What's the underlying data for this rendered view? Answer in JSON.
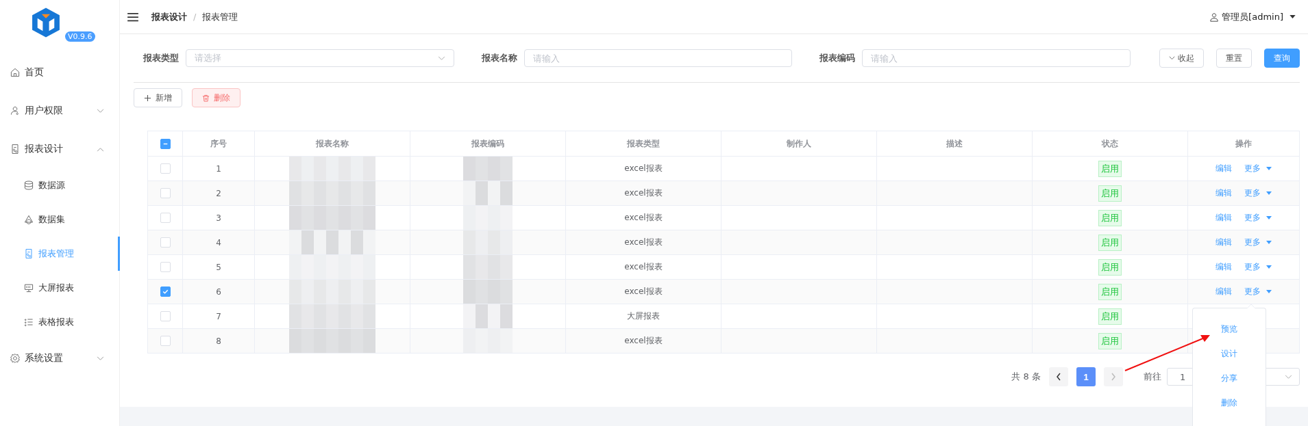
{
  "logo": {
    "version": "V0.9.6"
  },
  "sidebar": {
    "items": [
      {
        "label": "首页",
        "selected": false
      },
      {
        "label": "用户权限",
        "selected": false,
        "expanded": false
      },
      {
        "label": "报表设计",
        "selected": false,
        "expanded": true,
        "children": [
          {
            "label": "数据源",
            "selected": false
          },
          {
            "label": "数据集",
            "selected": false
          },
          {
            "label": "报表管理",
            "selected": true
          },
          {
            "label": "大屏报表",
            "selected": false
          },
          {
            "label": "表格报表",
            "selected": false
          }
        ]
      },
      {
        "label": "系统设置",
        "selected": false,
        "expanded": false
      }
    ]
  },
  "breadcrumb": [
    "报表设计",
    "报表管理"
  ],
  "breadcrumb_separator": "/",
  "user": {
    "name": "管理员[admin]"
  },
  "filters": [
    {
      "label": "报表类型",
      "kind": "select",
      "placeholder": "请选择"
    },
    {
      "label": "报表名称",
      "kind": "input",
      "placeholder": "请输入"
    },
    {
      "label": "报表编码",
      "kind": "input",
      "placeholder": "请输入"
    }
  ],
  "filter_buttons": [
    {
      "label": "收起",
      "kind": "collapse"
    },
    {
      "label": "重置",
      "kind": "plain"
    },
    {
      "label": "查询",
      "kind": "primary"
    }
  ],
  "actions": [
    {
      "label": "新增",
      "kind": "add"
    },
    {
      "label": "删除",
      "kind": "delete"
    }
  ],
  "table": {
    "all_checked": false,
    "partially_checked": true,
    "columns": [
      "序号",
      "报表名称",
      "报表编码",
      "报表类型",
      "制作人",
      "描述",
      "状态",
      "操作"
    ],
    "rows": [
      {
        "no": "1",
        "type": "excel报表",
        "status": "启用",
        "edit": "编辑",
        "more": "更多",
        "checked": false
      },
      {
        "no": "2",
        "type": "excel报表",
        "status": "启用",
        "edit": "编辑",
        "more": "更多",
        "checked": false
      },
      {
        "no": "3",
        "type": "excel报表",
        "status": "启用",
        "edit": "编辑",
        "more": "更多",
        "checked": false
      },
      {
        "no": "4",
        "type": "excel报表",
        "status": "启用",
        "edit": "编辑",
        "more": "更多",
        "checked": false
      },
      {
        "no": "5",
        "type": "excel报表",
        "status": "启用",
        "edit": "编辑",
        "more": "更多",
        "checked": false
      },
      {
        "no": "6",
        "type": "excel报表",
        "status": "启用",
        "edit": "编辑",
        "more": "更多",
        "checked": true
      },
      {
        "no": "7",
        "type": "大屏报表",
        "status": "启用",
        "checked": false
      },
      {
        "no": "8",
        "type": "excel报表",
        "status": "启用",
        "checked": false
      }
    ]
  },
  "pagination": {
    "total": "共 8 条",
    "pages": [
      {
        "label": "1",
        "selected": true
      }
    ],
    "goto_label": "前往",
    "goto_value": "1"
  },
  "more_menu": {
    "items": [
      "预览",
      "设计",
      "分享",
      "删除"
    ]
  }
}
